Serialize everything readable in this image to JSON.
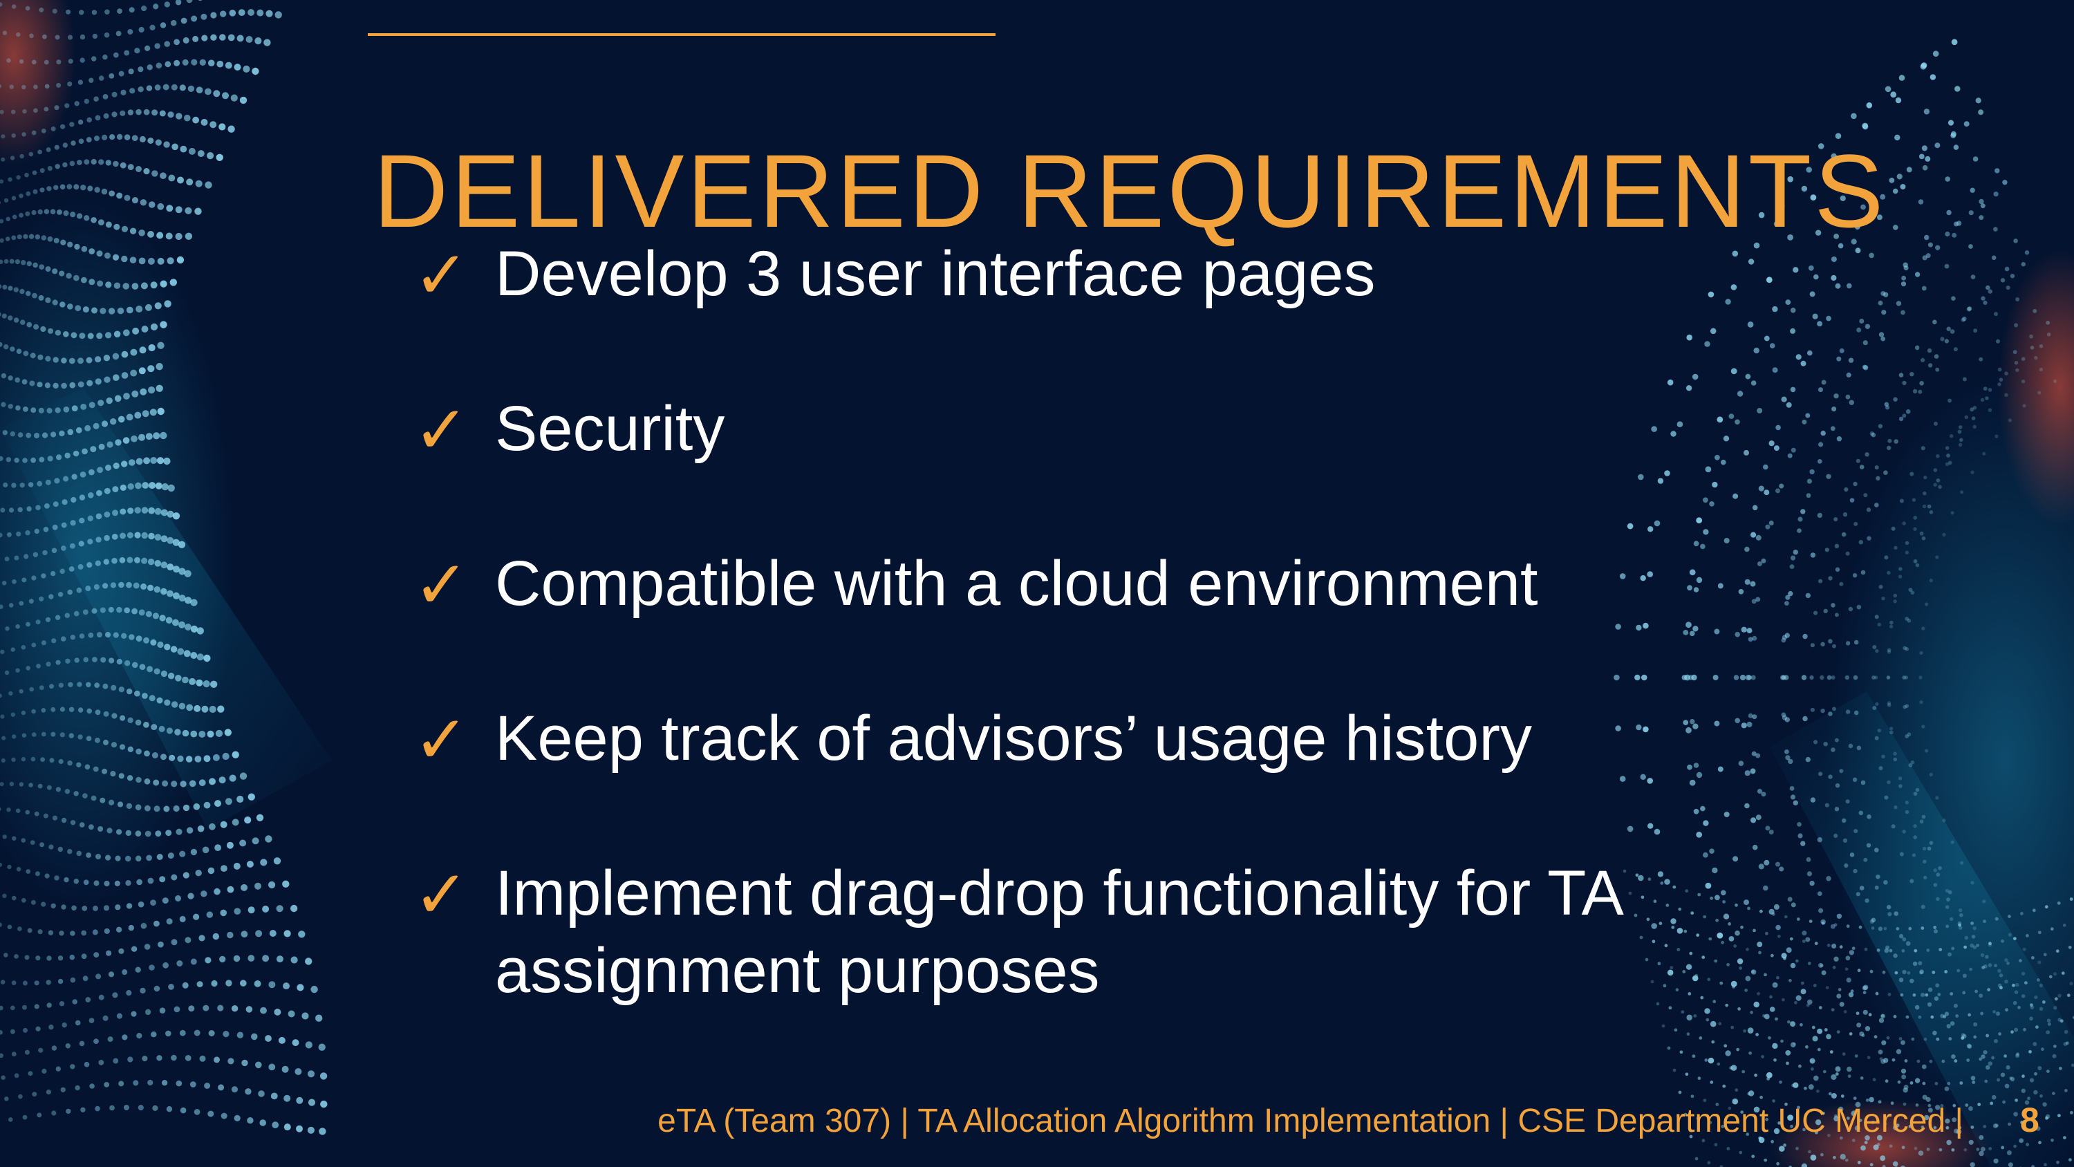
{
  "slide": {
    "title": "DELIVERED REQUIREMENTS",
    "accent_color": "#f3a33c",
    "background_color": "#031330",
    "check_icon": "checkmark-icon",
    "bullets": [
      {
        "check": "✓",
        "text": "Develop 3 user interface pages"
      },
      {
        "check": "✓",
        "text": "Security"
      },
      {
        "check": "✓",
        "text": "Compatible with a cloud environment"
      },
      {
        "check": "✓",
        "text": "Keep track of advisors’ usage history"
      },
      {
        "check": "✓",
        "text": "Implement drag-drop functionality for TA assignment purposes"
      }
    ],
    "footer": "eTA (Team 307) | TA Allocation Algorithm Implementation | CSE Department UC Merced |",
    "page_number": "8"
  }
}
